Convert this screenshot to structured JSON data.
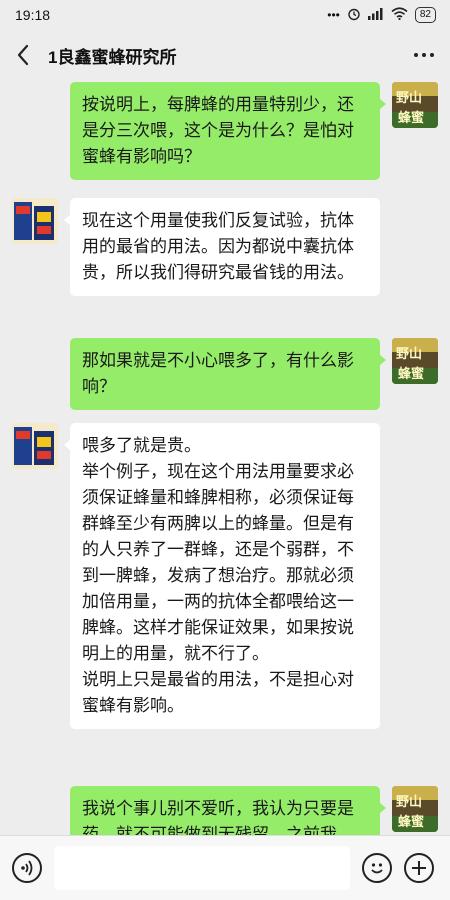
{
  "status_bar": {
    "time": "19:18",
    "signal": "4G",
    "battery": "82"
  },
  "header": {
    "title": "1良鑫蜜蜂研究所",
    "back_icon": "chevron-left-icon",
    "more_icon": "more-dots-icon"
  },
  "messages": [
    {
      "side": "sent",
      "text": "按说明上，每脾蜂的用量特别少，还是分三次喂，这个是为什么？是怕对蜜蜂有影响吗？"
    },
    {
      "side": "received",
      "text": "现在这个用量使我们反复试验，抗体用的最省的用法。因为都说中囊抗体贵，所以我们得研究最省钱的用法。"
    },
    {
      "side": "sent",
      "text": "那如果就是不小心喂多了，有什么影响？"
    },
    {
      "side": "received",
      "text": "喂多了就是贵。\n举个例子，现在这个用法用量要求必须保证蜂量和蜂脾相称，必须保证每群蜂至少有两脾以上的蜂量。但是有的人只养了一群蜂，还是个弱群，不到一脾蜂，发病了想治疗。那就必须加倍用量，一两的抗体全都喂给这一脾蜂。这样才能保证效果，如果按说明上的用量，就不行了。\n说明上只是最省的用法，不是担心对蜜蜂有影响。"
    },
    {
      "side": "sent",
      "text": "我说个事儿别不爱听，我认为只要是药，就不可能做到无残留，之前我"
    }
  ],
  "input_bar": {
    "voice_icon": "voice-icon",
    "emoji_icon": "emoji-icon",
    "plus_icon": "plus-icon",
    "placeholder": ""
  },
  "colors": {
    "background": "#ededed",
    "sent_bubble": "#95ec69",
    "received_bubble": "#ffffff"
  }
}
